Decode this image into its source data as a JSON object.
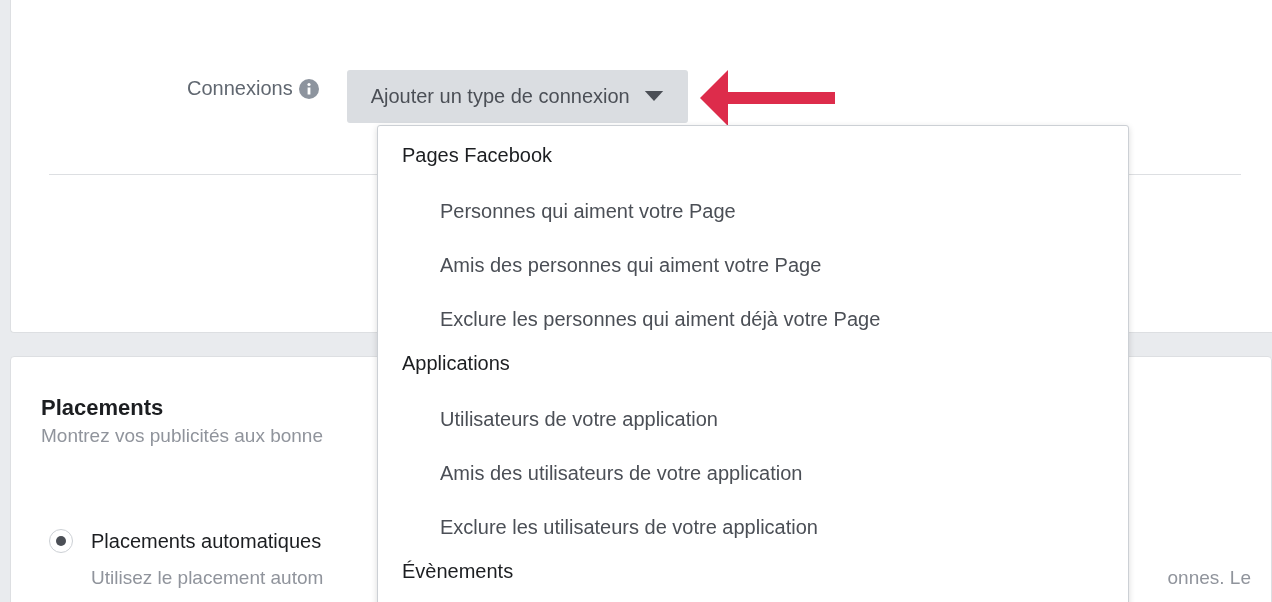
{
  "connections": {
    "label": "Connexions",
    "button": "Ajouter un type de connexion"
  },
  "dropdown": [
    {
      "kind": "header",
      "text": "Pages Facebook"
    },
    {
      "kind": "option",
      "text": "Personnes qui aiment votre Page"
    },
    {
      "kind": "option",
      "text": "Amis des personnes qui aiment votre Page"
    },
    {
      "kind": "option",
      "text": "Exclure les personnes qui aiment déjà votre Page"
    },
    {
      "kind": "header",
      "text": "Applications"
    },
    {
      "kind": "option",
      "text": "Utilisateurs de votre application"
    },
    {
      "kind": "option",
      "text": "Amis des utilisateurs de votre application"
    },
    {
      "kind": "option",
      "text": "Exclure les utilisateurs de votre application"
    },
    {
      "kind": "header",
      "text": "Évènements"
    }
  ],
  "placements": {
    "title": "Placements",
    "subtitle": "Montrez vos publicités aux bonne",
    "option": {
      "label": "Placements automatiques",
      "selected": true
    },
    "description_left": "Utilisez le placement autom",
    "description_right": "onnes. Le"
  }
}
